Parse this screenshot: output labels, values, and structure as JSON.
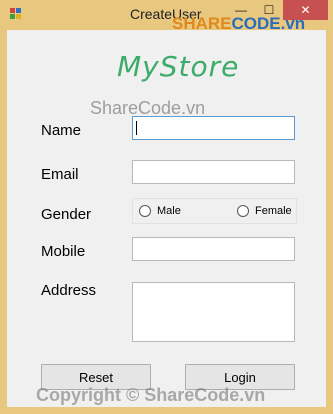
{
  "window": {
    "title": "CreateUser",
    "controls": {
      "minimize": "—",
      "maximize": "☐",
      "close": "✕"
    }
  },
  "brand": {
    "text": "MyStore",
    "color": "#3dab6a"
  },
  "form": {
    "name_label": "Name",
    "name_value": "",
    "email_label": "Email",
    "email_value": "",
    "gender_label": "Gender",
    "gender_options": [
      "Male",
      "Female"
    ],
    "mobile_label": "Mobile",
    "mobile_value": "",
    "address_label": "Address",
    "address_value": ""
  },
  "buttons": {
    "reset": "Reset",
    "login": "Login"
  },
  "watermarks": {
    "logo_share": "SHARE",
    "logo_code": "CODE.vn",
    "middle": "ShareCode.vn",
    "bottom": "Copyright © ShareCode.vn"
  }
}
